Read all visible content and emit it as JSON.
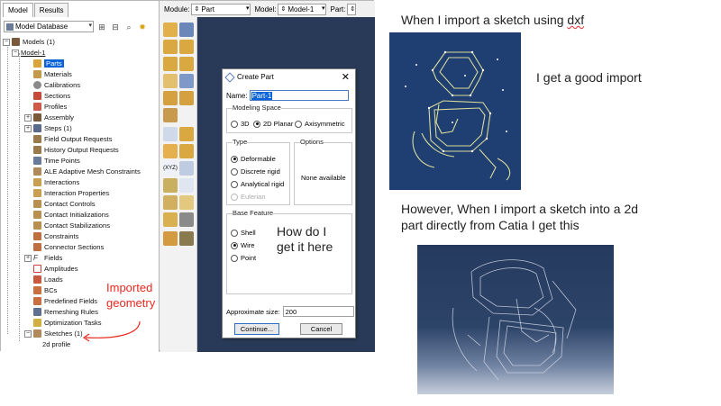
{
  "tree_panel": {
    "tabs": [
      "Model",
      "Results"
    ],
    "database": "Model Database",
    "models_root": "Models (1)",
    "model": "Model-1",
    "items": [
      "Parts",
      "Materials",
      "Calibrations",
      "Sections",
      "Profiles",
      "Assembly",
      "Steps (1)",
      "Field Output Requests",
      "History Output Requests",
      "Time Points",
      "ALE Adaptive Mesh Constraints",
      "Interactions",
      "Interaction Properties",
      "Contact Controls",
      "Contact Initializations",
      "Contact Stabilizations",
      "Constraints",
      "Connector Sections",
      "Fields",
      "Amplitudes",
      "Loads",
      "BCs",
      "Predefined Fields",
      "Remeshing Rules",
      "Optimization Tasks",
      "Sketches (1)",
      "2d profile"
    ]
  },
  "context_bar": {
    "module_label": "Module:",
    "module_value": "Part",
    "model_label": "Model:",
    "model_value": "Model-1",
    "part_label": "Part:"
  },
  "dialog": {
    "title": "Create Part",
    "name_label": "Name:",
    "name_value": "Part-1",
    "modeling_space_label": "Modeling Space",
    "space_options": [
      "3D",
      "2D Planar",
      "Axisymmetric"
    ],
    "selected_space": "2D Planar",
    "type_label": "Type",
    "type_options": [
      "Deformable",
      "Discrete rigid",
      "Analytical rigid",
      "Eulerian"
    ],
    "options_label": "Options",
    "options_text": "None available",
    "base_feature_label": "Base Feature",
    "base_options": [
      "Shell",
      "Wire",
      "Point"
    ],
    "approx_label": "Approximate size:",
    "approx_value": "200",
    "continue_label": "Continue...",
    "cancel_label": "Cancel"
  },
  "annotations": {
    "how_line1": "How do I",
    "how_line2": "get it here",
    "imported_line1": "Imported",
    "imported_line2": "geometry"
  },
  "right_text": {
    "line1_pre": "When I import a sketch using ",
    "line1_word": "dxf",
    "good": "I get a good import",
    "however1": "However, When I import a sketch into a 2d",
    "however2": "part  directly from Catia I get this"
  },
  "colors": {
    "viewport": "#283a57",
    "annotation_red": "#e8281e",
    "selection_blue": "#0a64d8"
  }
}
